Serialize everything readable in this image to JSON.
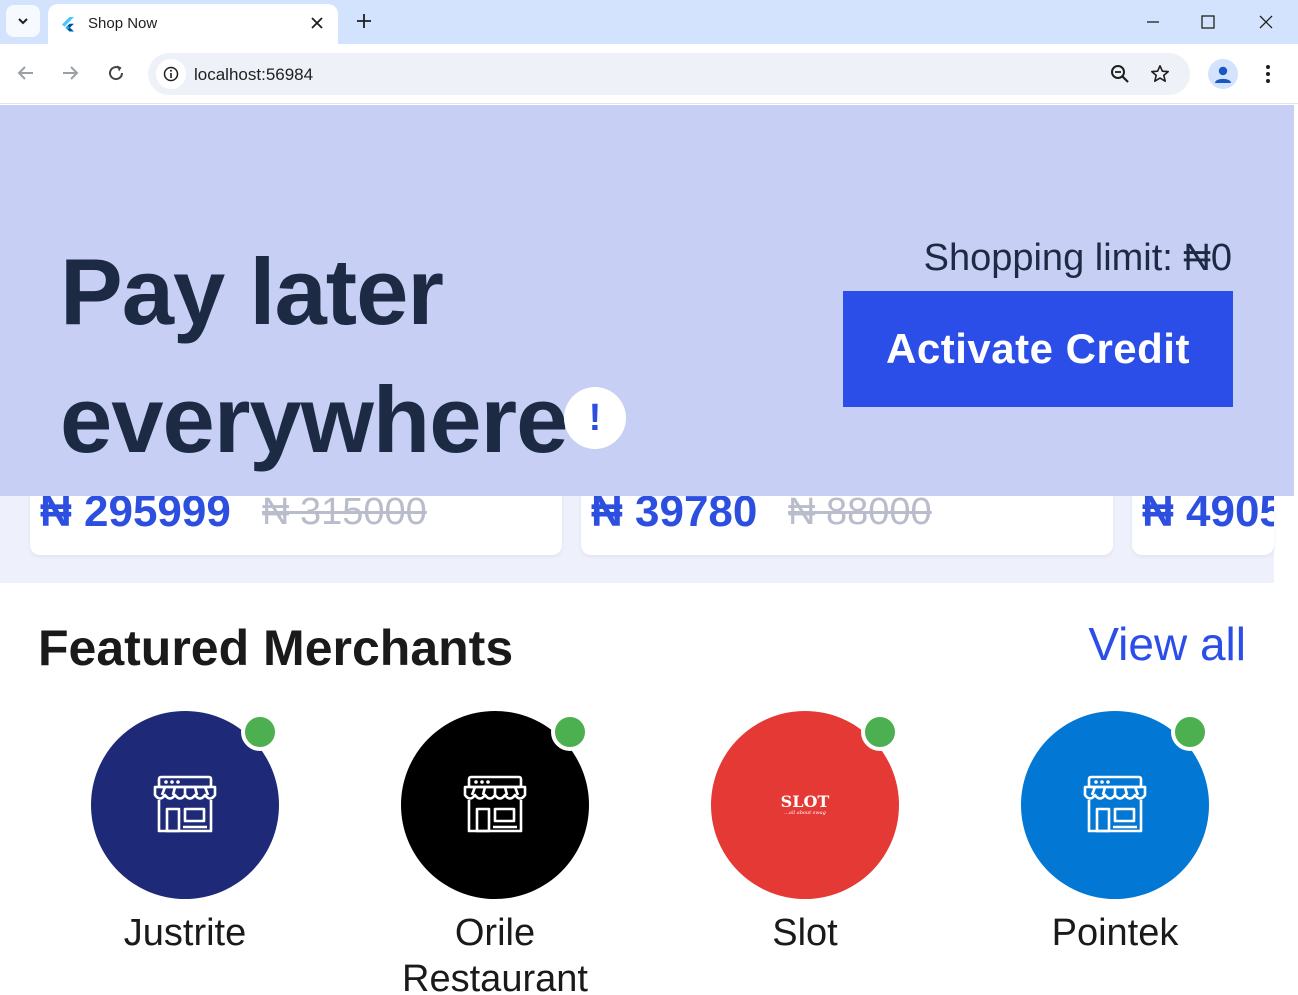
{
  "browser": {
    "tab_title": "Shop Now",
    "url": "localhost:56984"
  },
  "banner": {
    "headline_line1": "Pay later",
    "headline_line2": "everywhere",
    "exclaim": "!",
    "shopping_limit": "Shopping limit: ₦0",
    "activate_label": "Activate Credit"
  },
  "deals": [
    {
      "price": "₦ 295999",
      "old_price": "₦ 315000"
    },
    {
      "price": "₦ 39780",
      "old_price": "₦ 88000"
    },
    {
      "price": "₦ 4905",
      "old_price": ""
    }
  ],
  "featured": {
    "title": "Featured Merchants",
    "view_all": "View all",
    "merchants": [
      {
        "name": "Justrite",
        "color": "#1e2a78",
        "icon": "store-icon",
        "online": true
      },
      {
        "name": "Orile Restaurant",
        "color": "#000000",
        "icon": "store-icon",
        "online": true
      },
      {
        "name": "Slot",
        "color": "#e53935",
        "icon": "slot-logo",
        "logo_text": "SLOT",
        "logo_sub": "...all about swag",
        "online": true
      },
      {
        "name": "Pointek",
        "color": "#0277d4",
        "icon": "store-icon",
        "online": true
      }
    ]
  },
  "colors": {
    "brand_blue": "#2b4ee8",
    "banner_bg": "#c7cff5",
    "online_green": "#4caf50"
  }
}
